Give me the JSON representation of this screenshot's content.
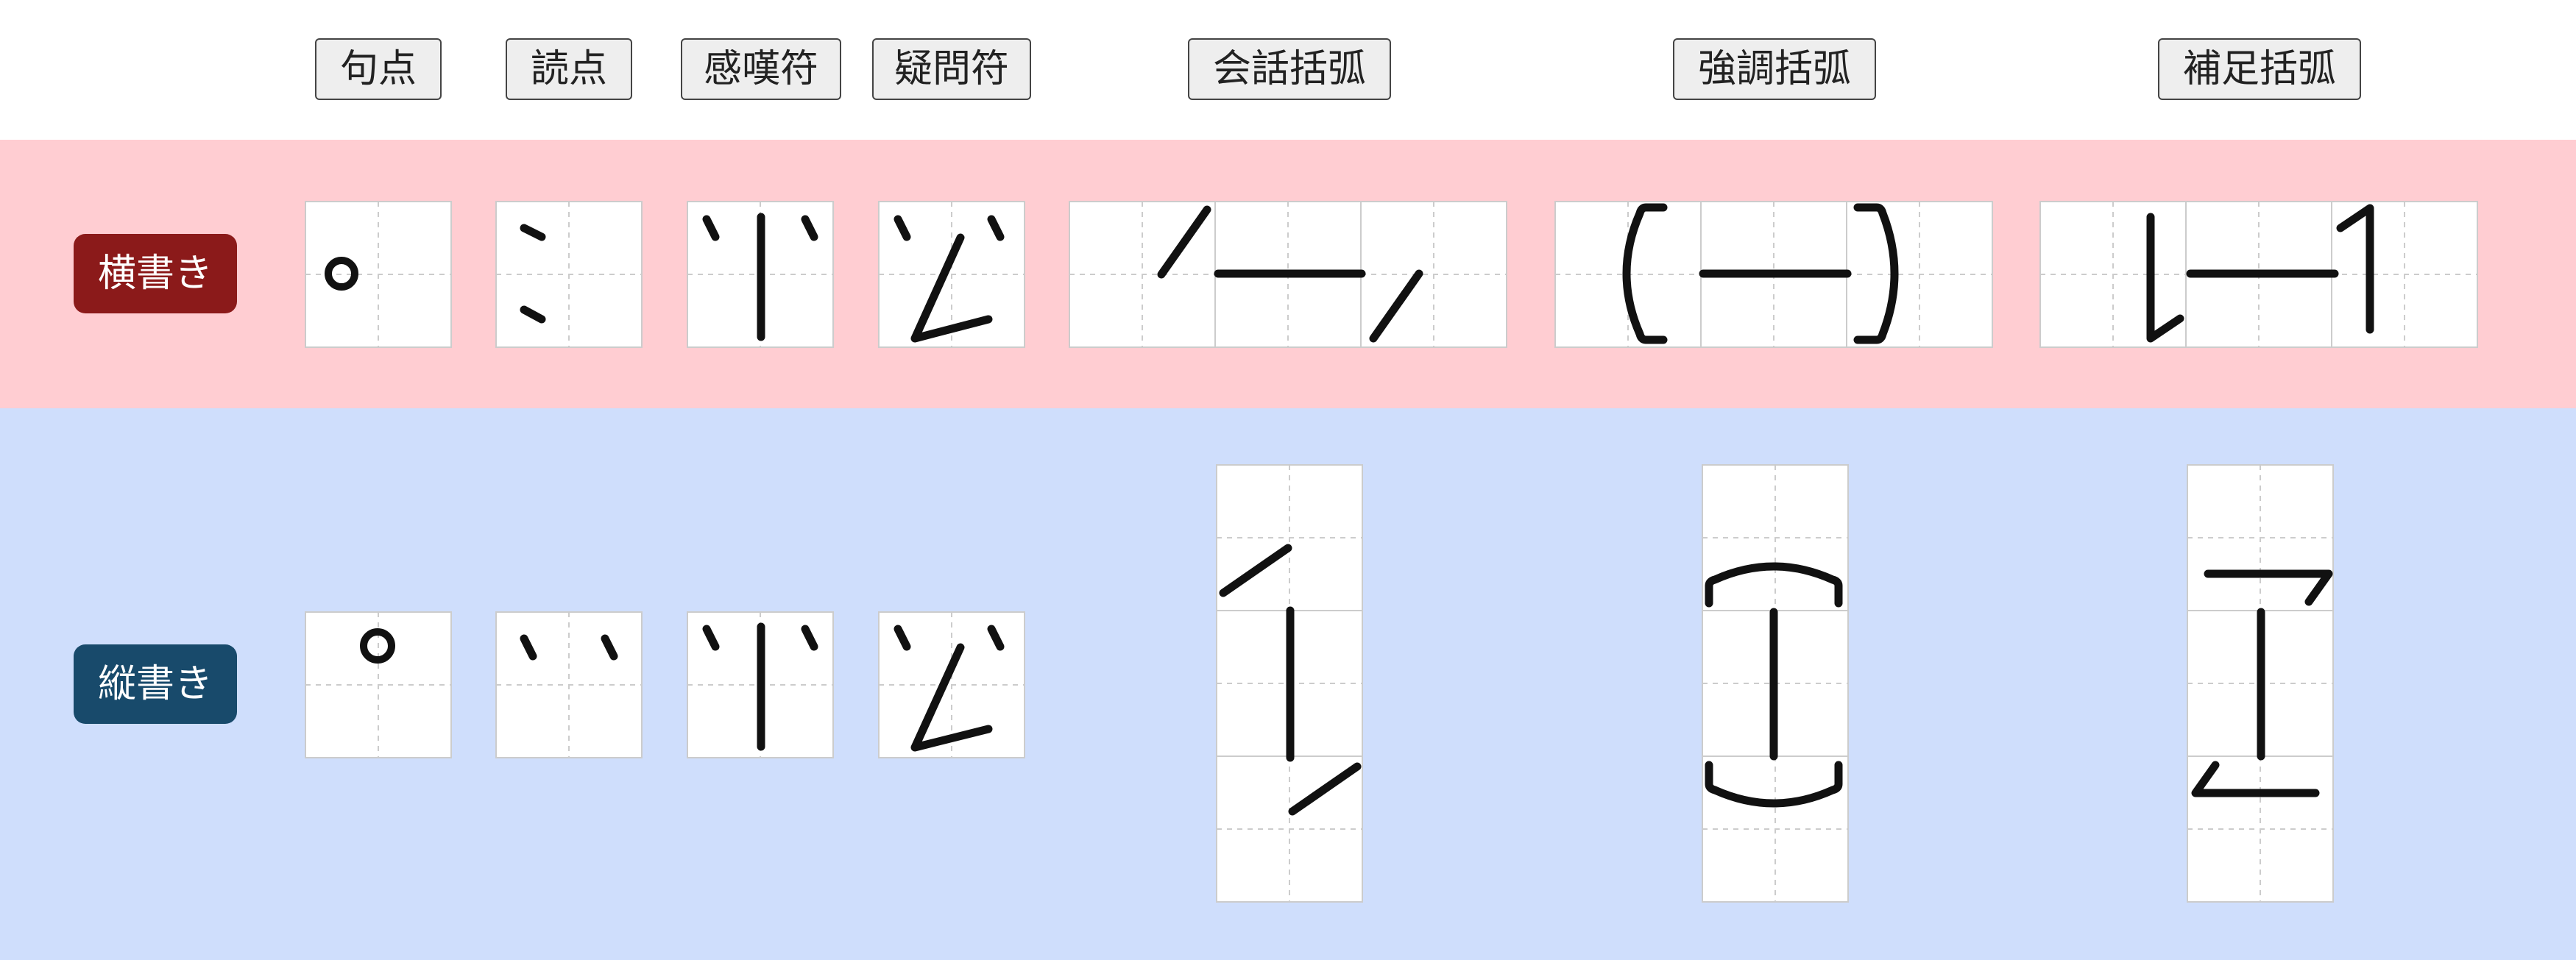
{
  "colors": {
    "horizontal_band": "#ffcdd2",
    "vertical_band": "#cfdefc",
    "horizontal_badge": "#8b1a1a",
    "vertical_badge": "#184a6b"
  },
  "columns": [
    {
      "id": "kuten",
      "label": "句点"
    },
    {
      "id": "touten",
      "label": "読点"
    },
    {
      "id": "kantanfu",
      "label": "感嘆符"
    },
    {
      "id": "gimonfu",
      "label": "疑問符"
    },
    {
      "id": "kaiwa-kakko",
      "label": "会話括弧"
    },
    {
      "id": "kyouchou-kakko",
      "label": "強調括弧"
    },
    {
      "id": "hosoku-kakko",
      "label": "補足括弧"
    }
  ],
  "rows": [
    {
      "id": "yokogaki",
      "label": "横書き"
    },
    {
      "id": "tategaki",
      "label": "縦書き"
    }
  ]
}
